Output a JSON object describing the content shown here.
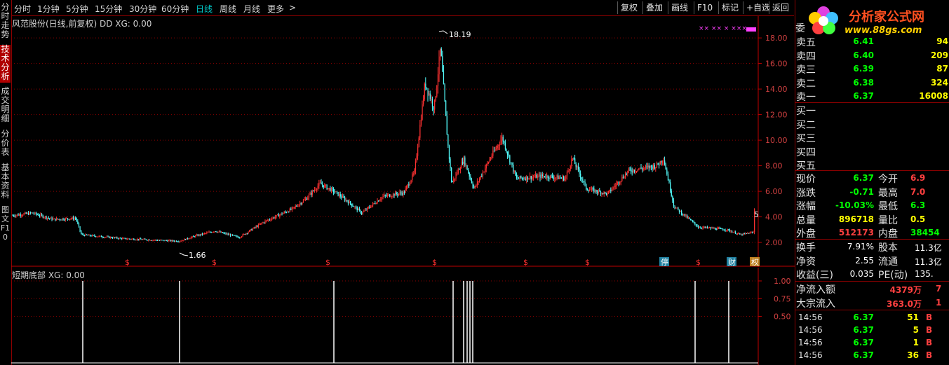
{
  "left_tabs": [
    {
      "label": "分时走势"
    },
    {
      "label": "技术分析"
    },
    {
      "label": "成交明细"
    },
    {
      "label": "分价表"
    },
    {
      "label": "基本资料"
    },
    {
      "label": "图文F10"
    }
  ],
  "periods": [
    "分时",
    "1分钟",
    "5分钟",
    "15分钟",
    "30分钟",
    "60分钟",
    "日线",
    "周线",
    "月线",
    "更多"
  ],
  "toolbar_buttons": [
    "复权",
    "叠加",
    "画线",
    "F10",
    "标记",
    "+自选",
    "返回"
  ],
  "main_chart": {
    "title": "风范股份(日线,前复权) DD XG: 0.00",
    "high_label": "18.19",
    "low_label": "1.66",
    "y_ticks": [
      "18.00",
      "16.00",
      "14.00",
      "12.00",
      "10.00",
      "8.00",
      "6.00",
      "4.00",
      "2.00"
    ],
    "markers": [
      "$",
      "$",
      "$",
      "$",
      "$",
      "$",
      "停",
      "$",
      "财",
      "权"
    ],
    "side_value": "5"
  },
  "sub_chart": {
    "title": "短期底部 XG: 0.00",
    "y_ticks": [
      "1.00",
      "0.75",
      "0.50"
    ]
  },
  "logo": {
    "name": "分析家公式网",
    "url": "www.88gs.com"
  },
  "order_book": {
    "header": "委",
    "sell": [
      {
        "label": "卖五",
        "price": "6.41",
        "vol": "94"
      },
      {
        "label": "卖四",
        "price": "6.40",
        "vol": "209"
      },
      {
        "label": "卖三",
        "price": "6.39",
        "vol": "87"
      },
      {
        "label": "卖二",
        "price": "6.38",
        "vol": "324"
      },
      {
        "label": "卖一",
        "price": "6.37",
        "vol": "16008"
      }
    ],
    "buy": [
      {
        "label": "买一"
      },
      {
        "label": "买二"
      },
      {
        "label": "买三"
      },
      {
        "label": "买四"
      },
      {
        "label": "买五"
      }
    ]
  },
  "quote": {
    "rows": [
      {
        "l1": "现价",
        "v1": "6.37",
        "c1": "#00ff00",
        "l2": "今开",
        "v2": "6.9",
        "c2": "#ff4040"
      },
      {
        "l1": "涨跌",
        "v1": "-0.71",
        "c1": "#00ff00",
        "l2": "最高",
        "v2": "7.0",
        "c2": "#ff4040"
      },
      {
        "l1": "涨幅",
        "v1": "-10.03%",
        "c1": "#00ff00",
        "l2": "最低",
        "v2": "6.3",
        "c2": "#00ff00"
      },
      {
        "l1": "总量",
        "v1": "896718",
        "c1": "#ffff00",
        "l2": "量比",
        "v2": "0.5",
        "c2": "#ffff00"
      },
      {
        "l1": "外盘",
        "v1": "512173",
        "c1": "#ff4040",
        "l2": "内盘",
        "v2": "38454",
        "c2": "#00ff00"
      }
    ],
    "rows2": [
      {
        "l1": "换手",
        "v1": "7.91%",
        "l2": "股本",
        "v2": "11.3亿"
      },
      {
        "l1": "净资",
        "v1": "2.55",
        "l2": "流通",
        "v2": "11.3亿"
      },
      {
        "l1": "收益(三)",
        "v1": "0.035",
        "l2": "PE(动)",
        "v2": "135."
      }
    ],
    "flow": [
      {
        "label": "净流入额",
        "val": "4379万",
        "extra": "7"
      },
      {
        "label": "大宗流入",
        "val": "363.0万",
        "extra": "1"
      }
    ]
  },
  "ticks": [
    {
      "time": "14:56",
      "price": "6.37",
      "vol": "51",
      "side": "B"
    },
    {
      "time": "14:56",
      "price": "6.37",
      "vol": "5",
      "side": "B"
    },
    {
      "time": "14:56",
      "price": "6.37",
      "vol": "1",
      "side": "B"
    },
    {
      "time": "14:56",
      "price": "6.37",
      "vol": "36",
      "side": "B"
    }
  ],
  "colors": {
    "up": "#ff3232",
    "down": "#54ffff",
    "grid": "#8b0000",
    "axis": "#c00000"
  }
}
